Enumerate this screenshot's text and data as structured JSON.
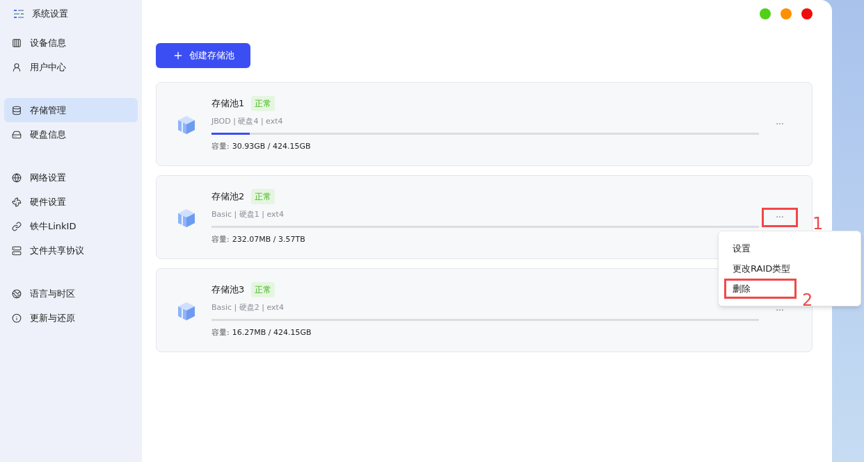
{
  "app": {
    "title": "系统设置"
  },
  "sidebar": {
    "groups": [
      {
        "items": [
          {
            "label": "设备信息",
            "selected": false
          },
          {
            "label": "用户中心",
            "selected": false
          }
        ]
      },
      {
        "items": [
          {
            "label": "存储管理",
            "selected": true
          },
          {
            "label": "硬盘信息",
            "selected": false
          }
        ]
      },
      {
        "items": [
          {
            "label": "网络设置",
            "selected": false
          },
          {
            "label": "硬件设置",
            "selected": false
          },
          {
            "label": "铁牛LinkID",
            "selected": false
          },
          {
            "label": "文件共享协议",
            "selected": false
          }
        ]
      },
      {
        "items": [
          {
            "label": "语言与时区",
            "selected": false
          },
          {
            "label": "更新与还原",
            "selected": false
          }
        ]
      }
    ]
  },
  "window_controls": [
    {
      "color": "#52d017"
    },
    {
      "color": "#ff9000"
    },
    {
      "color": "#ee0e0e"
    }
  ],
  "create_button": {
    "label": "创建存储池"
  },
  "pools": [
    {
      "name": "存储池1",
      "status": "正常",
      "details": "JBOD | 硬盘4 | ext4",
      "level": 0.07,
      "capacity_label": "容量:",
      "capacity": "30.93GB / 424.15GB",
      "more": "···",
      "marked": false
    },
    {
      "name": "存储池2",
      "status": "正常",
      "details": "Basic | 硬盘1 | ext4",
      "level": 0,
      "capacity_label": "容量:",
      "capacity": "232.07MB / 3.57TB",
      "more": "···",
      "marked": true
    },
    {
      "name": "存储池3",
      "status": "正常",
      "details": "Basic | 硬盘2 | ext4",
      "level": 0,
      "capacity_label": "容量:",
      "capacity": "16.27MB / 424.15GB",
      "more": "···",
      "marked": false
    }
  ],
  "context_menu": {
    "items": [
      {
        "label": "设置",
        "marked": false
      },
      {
        "label": "更改RAID类型",
        "marked": false
      },
      {
        "label": "删除",
        "marked": true
      }
    ]
  },
  "annotations": [
    {
      "label": "1"
    },
    {
      "label": "2"
    }
  ]
}
